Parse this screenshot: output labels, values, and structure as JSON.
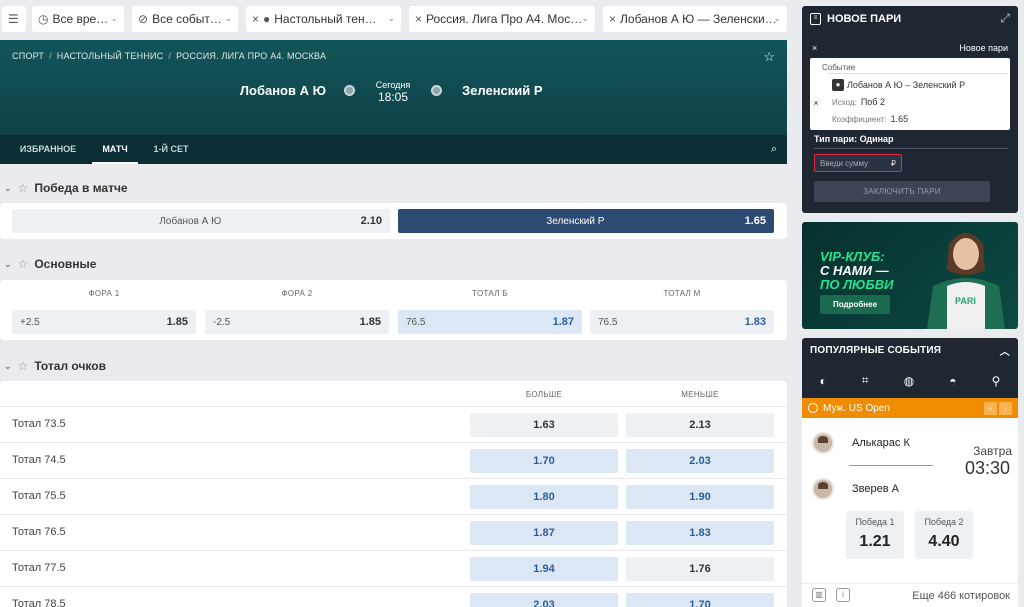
{
  "filters": [
    {
      "icon": "settings-sliders-icon",
      "glyph": "⚙",
      "label": ""
    },
    {
      "icon": "clock-icon",
      "glyph": "◷",
      "label": "Все вре…"
    },
    {
      "icon": "compass-icon",
      "glyph": "⊘",
      "label": "Все событ…"
    },
    {
      "icon": "table-tennis-icon",
      "glyph": "🏓",
      "label": "Настольный тен…",
      "close": "×"
    },
    {
      "icon": "close-icon",
      "glyph": "×",
      "label": "Россия. Лига Про А4. Мос…"
    },
    {
      "icon": "close-icon",
      "glyph": "×",
      "label": "Лобанов А Ю — Зеленски…"
    }
  ],
  "breadcrumbs": [
    "СПОРТ",
    "НАСТОЛЬНЫЙ ТЕННИС",
    "РОССИЯ. ЛИГА ПРО А4. МОСКВА"
  ],
  "match": {
    "team1": "Лобанов А Ю",
    "team2": "Зеленский Р",
    "day": "Сегодня",
    "time": "18:05"
  },
  "tabs": [
    "ИЗБРАННОЕ",
    "МАТЧ",
    "1-Й СЕТ"
  ],
  "win": {
    "title": "Победа в матче",
    "options": [
      {
        "name": "Лобанов А Ю",
        "odd": "2.10"
      },
      {
        "name": "Зеленский Р",
        "odd": "1.65"
      }
    ]
  },
  "main": {
    "title": "Основные",
    "headers": [
      "ФОРА 1",
      "ФОРА 2",
      "ТОТАЛ Б",
      "ТОТАЛ М"
    ],
    "cells": [
      {
        "l": "+2.5",
        "v": "1.85"
      },
      {
        "l": "-2.5",
        "v": "1.85"
      },
      {
        "l": "76.5",
        "v": "1.87"
      },
      {
        "l": "76.5",
        "v": "1.83"
      }
    ]
  },
  "totals": {
    "title": "Тотал очков",
    "col_over": "БОЛЬШЕ",
    "col_under": "МЕНЬШЕ",
    "rows": [
      {
        "name": "Тотал 73.5",
        "over": "1.63",
        "under": "2.13"
      },
      {
        "name": "Тотал 74.5",
        "over": "1.70",
        "under": "2.03"
      },
      {
        "name": "Тотал 75.5",
        "over": "1.80",
        "under": "1.90"
      },
      {
        "name": "Тотал 76.5",
        "over": "1.87",
        "under": "1.83"
      },
      {
        "name": "Тотал 77.5",
        "over": "1.94",
        "under": "1.76"
      },
      {
        "name": "Тотал 78.5",
        "over": "2.03",
        "under": "1.70"
      }
    ]
  },
  "betslip": {
    "title": "НОВОЕ ПАРИ",
    "close": "×",
    "new_label": "Новое пари",
    "event_header": "Событие",
    "event": "Лобанов А Ю – Зеленский Р",
    "outcome_label": "Исход:",
    "outcome": "Поб 2",
    "coef_label": "Коэффициент:",
    "coef": "1.65",
    "bet_type": "Тип пари: Одинар",
    "amount_placeholder": "Введи сумму",
    "currency": "₽",
    "submit": "ЗАКЛЮЧИТЬ ПАРИ"
  },
  "ad": {
    "line1": "VIP-КЛУБ:",
    "line2": "С НАМИ —",
    "line3": "ПО ЛЮБВИ",
    "button": "Подробнее"
  },
  "popular": {
    "title": "ПОПУЛЯРНЫЕ СОБЫТИЯ",
    "tournament": "Муж. US Open",
    "player1": "Алькарас К",
    "player2": "Зверев А",
    "day": "Завтра",
    "time": "03:30",
    "odds": [
      {
        "label": "Победа 1",
        "value": "1.21"
      },
      {
        "label": "Победа 2",
        "value": "4.40"
      }
    ],
    "more": "Еще 466 котировок"
  },
  "colors": {
    "accent": "#2d4b72",
    "brand_dark": "#1f2733",
    "promo": "#f08c00",
    "hero": "#0e3c43"
  }
}
